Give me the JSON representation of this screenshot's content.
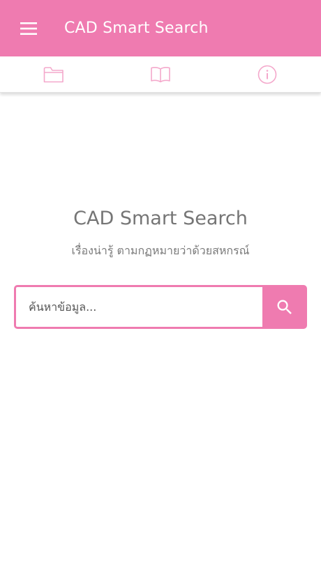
{
  "appbar": {
    "title": "CAD Smart Search",
    "menu_icon": "hamburger-menu-icon"
  },
  "tabs": [
    {
      "icon": "folder-icon"
    },
    {
      "icon": "book-open-icon"
    },
    {
      "icon": "info-icon"
    }
  ],
  "hero": {
    "title": "CAD Smart Search",
    "subtitle": "เรื่องน่ารู้ ตามกฏหมายว่าด้วยสหกรณ์"
  },
  "search": {
    "value": "",
    "placeholder": "ค้นหาข้อมูล...",
    "button_icon": "search-icon"
  },
  "colors": {
    "primary": "#ef7bb0",
    "tab_icon": "#f4a8cb",
    "text_gray": "#757575"
  }
}
